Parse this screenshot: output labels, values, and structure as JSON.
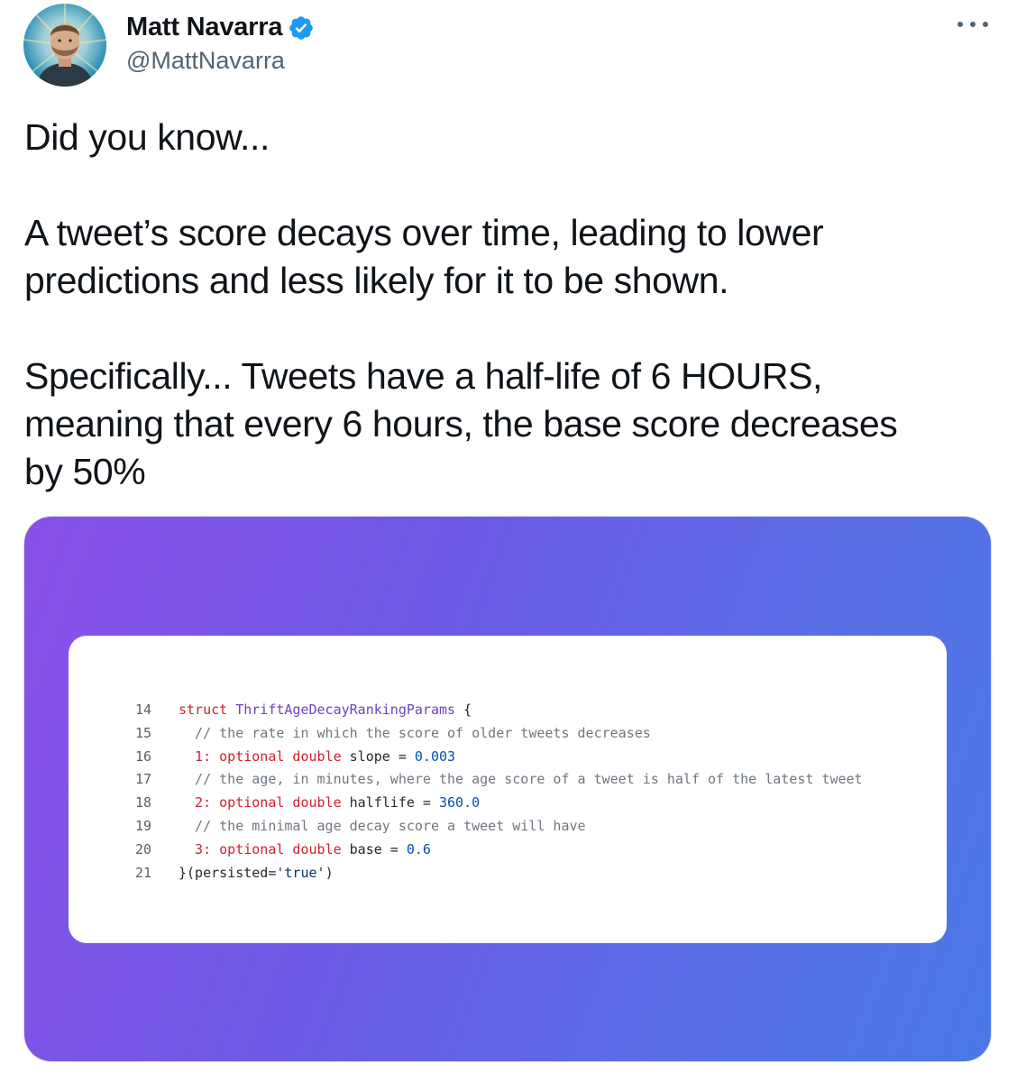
{
  "author": {
    "display_name": "Matt Navarra",
    "handle": "@MattNavarra",
    "verified": true
  },
  "tweet": {
    "lines": [
      "Did you know...",
      "",
      "A tweet’s score decays over time, leading to lower",
      "predictions and less likely for it to be shown.",
      "",
      "Specifically... Tweets have a half-life of 6 HOURS,",
      "meaning that every 6 hours, the base score decreases",
      "by 50%"
    ]
  },
  "code": {
    "lines": [
      {
        "n": "14",
        "tokens": [
          [
            "kw",
            "struct "
          ],
          [
            "ty",
            "ThriftAgeDecayRankingParams"
          ],
          [
            "pl",
            " {"
          ]
        ]
      },
      {
        "n": "15",
        "tokens": [
          [
            "cm",
            "  // the rate in which the score of older tweets decreases"
          ]
        ]
      },
      {
        "n": "16",
        "tokens": [
          [
            "kw",
            "  1: optional double "
          ],
          [
            "pl",
            "slope = "
          ],
          [
            "num",
            "0.003"
          ]
        ]
      },
      {
        "n": "17",
        "tokens": [
          [
            "cm",
            "  // the age, in minutes, where the age score of a tweet is half of the latest tweet"
          ]
        ]
      },
      {
        "n": "18",
        "tokens": [
          [
            "kw",
            "  2: optional double "
          ],
          [
            "pl",
            "halflife = "
          ],
          [
            "num",
            "360.0"
          ]
        ]
      },
      {
        "n": "19",
        "tokens": [
          [
            "cm",
            "  // the minimal age decay score a tweet will have"
          ]
        ]
      },
      {
        "n": "20",
        "tokens": [
          [
            "kw",
            "  3: optional double "
          ],
          [
            "pl",
            "base = "
          ],
          [
            "num",
            "0.6"
          ]
        ]
      },
      {
        "n": "21",
        "tokens": [
          [
            "pl",
            "}(persisted="
          ],
          [
            "str",
            "'true'"
          ],
          [
            "pl",
            ")"
          ]
        ]
      }
    ]
  },
  "colors": {
    "verified_badge": "#1d9bf0",
    "gradient_start": "#8a50e8",
    "gradient_end": "#4a78e6"
  },
  "icons": {
    "avatar": "avatar-photo",
    "verified": "verified-badge-icon",
    "more": "more-options-icon"
  }
}
